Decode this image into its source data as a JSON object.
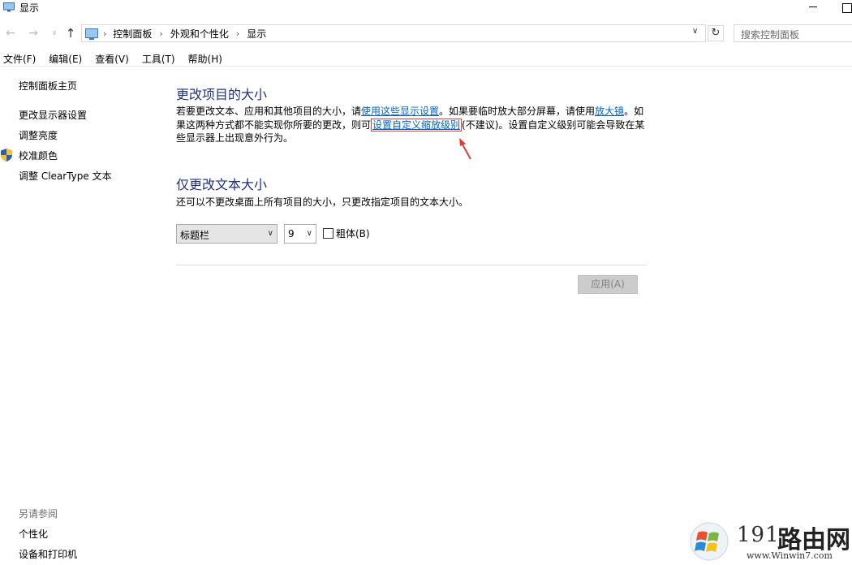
{
  "window": {
    "title": "显示"
  },
  "address": {
    "crumbs": [
      "控制面板",
      "外观和个性化",
      "显示"
    ]
  },
  "search": {
    "placeholder": "搜索控制面板"
  },
  "menu": [
    "文件(F)",
    "编辑(E)",
    "查看(V)",
    "工具(T)",
    "帮助(H)"
  ],
  "sidebar": {
    "home": "控制面板主页",
    "items": [
      "更改显示器设置",
      "调整亮度",
      "校准颜色",
      "调整 ClearType 文本"
    ],
    "see_also_title": "另请参阅",
    "see_also": [
      "个性化",
      "设备和打印机"
    ]
  },
  "main": {
    "section1_title": "更改项目的大小",
    "para": {
      "t1": "若要更改文本、应用和其他项目的大小，请",
      "link1": "使用这些显示设置",
      "t2": "。如果要临时放大部分屏幕，请使用",
      "link2": "放大镜",
      "t3": "。如果这两种方式都不能实现你所要的更改，则可",
      "link3": "设置自定义缩放级别",
      "t4": "(不建议)。设置自定义级别可能会导致在某些显示器上出现意外行为。"
    },
    "section2_title": "仅更改文本大小",
    "section2_desc": "还可以不更改桌面上所有项目的大小，只更改指定项目的文本大小。",
    "item_select": "标题栏",
    "size_select": "9",
    "bold_label": "粗体(B)",
    "bold_checked": false,
    "apply_label": "应用(A)"
  },
  "watermark": {
    "number": "191",
    "name": "路由网",
    "url": "www.Winwin7.com"
  },
  "colors": {
    "heading": "#1e3287",
    "link": "#0066cc",
    "annotation": "#e13b3b"
  }
}
